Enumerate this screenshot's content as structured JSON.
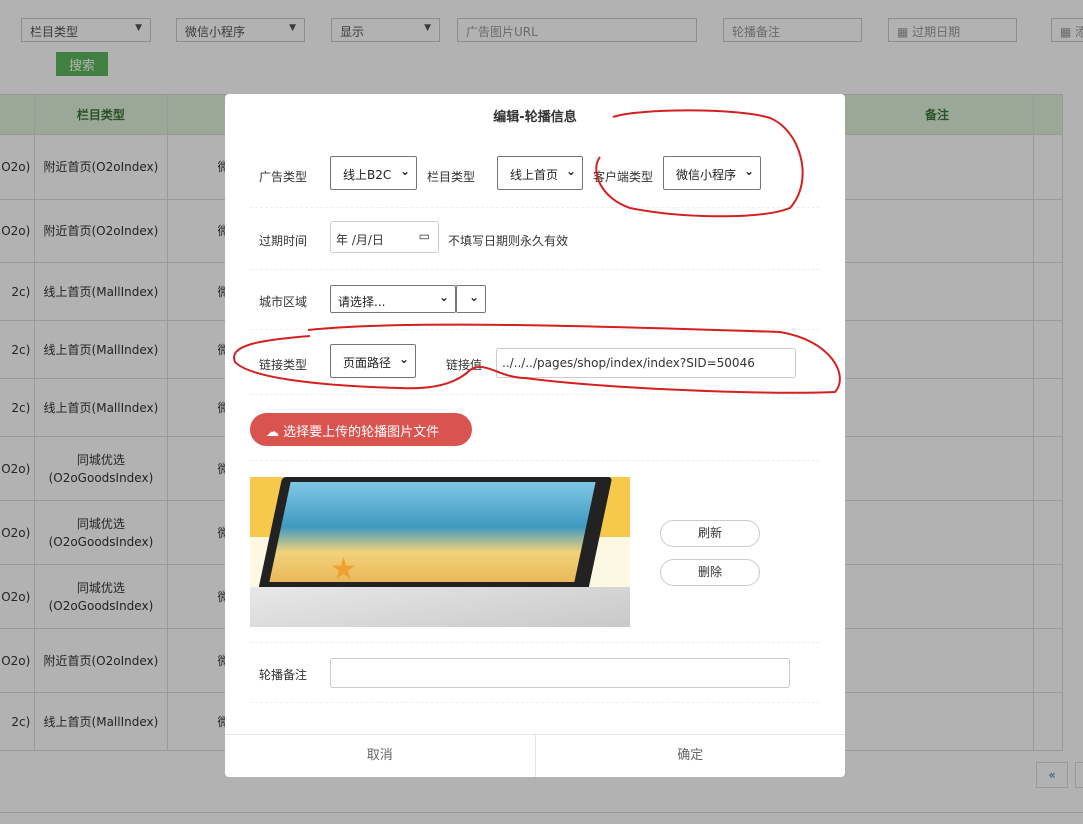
{
  "filters": {
    "column_type": "栏目类型",
    "client": "微信小程序",
    "display": "显示",
    "url_placeholder": "广告图片URL",
    "note_placeholder": "轮播备注",
    "expire_placeholder": "过期日期",
    "add_placeholder": "添",
    "search": "搜索"
  },
  "table": {
    "headers": [
      "",
      "栏目类型",
      "",
      "备注"
    ],
    "rows": [
      [
        "O2o)",
        "附近首页(O2oIndex)",
        "微"
      ],
      [
        "O2o)",
        "附近首页(O2oIndex)",
        "微"
      ],
      [
        "2c)",
        "线上首页(MallIndex)",
        "微"
      ],
      [
        "2c)",
        "线上首页(MallIndex)",
        "微"
      ],
      [
        "2c)",
        "线上首页(MallIndex)",
        "微"
      ],
      [
        "O2o)",
        "同城优选(O2oGoodsIndex)",
        "微"
      ],
      [
        "O2o)",
        "同城优选(O2oGoodsIndex)",
        "微"
      ],
      [
        "O2o)",
        "同城优选(O2oGoodsIndex)",
        "微"
      ],
      [
        "O2o)",
        "附近首页(O2oIndex)",
        "微"
      ],
      [
        "2c)",
        "线上首页(MallIndex)",
        "微"
      ]
    ]
  },
  "pager": {
    "prev": "«"
  },
  "modal": {
    "title": "编辑-轮播信息",
    "ad_type_label": "广告类型",
    "ad_type": "线上B2C",
    "column_type_label": "栏目类型",
    "column_type": "线上首页",
    "client_type_label": "客户端类型",
    "client_type": "微信小程序",
    "expire_label": "过期时间",
    "expire_value": "年 /月/日",
    "expire_hint": "不填写日期则永久有效",
    "city_label": "城市区域",
    "city_value": "请选择...",
    "link_type_label": "链接类型",
    "link_type": "页面路径",
    "link_value_label": "链接值",
    "link_value": "../../../pages/shop/index/index?SID=50046",
    "upload": "选择要上传的轮播图片文件",
    "refresh": "刷新",
    "delete": "删除",
    "note_label": "轮播备注",
    "note_value": "",
    "cancel": "取消",
    "confirm": "确定"
  }
}
